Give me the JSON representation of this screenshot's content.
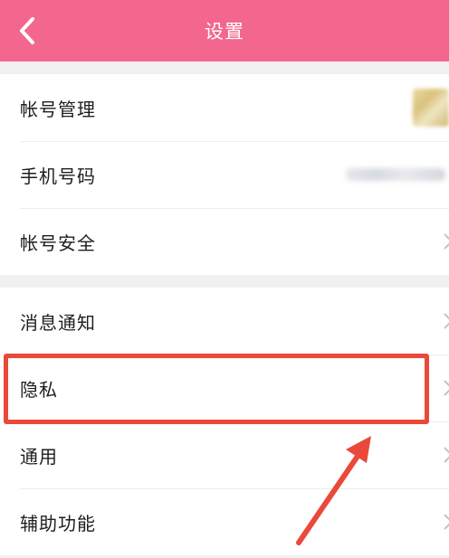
{
  "header": {
    "title": "设置",
    "background_color": "#f3678e"
  },
  "group1": {
    "items": [
      {
        "label": "帐号管理"
      },
      {
        "label": "手机号码"
      },
      {
        "label": "帐号安全"
      }
    ]
  },
  "group2": {
    "items": [
      {
        "label": "消息通知"
      },
      {
        "label": "隐私"
      },
      {
        "label": "通用"
      },
      {
        "label": "辅助功能"
      }
    ]
  },
  "annotation": {
    "color": "#e9483a",
    "highlighted_item": "隐私"
  }
}
